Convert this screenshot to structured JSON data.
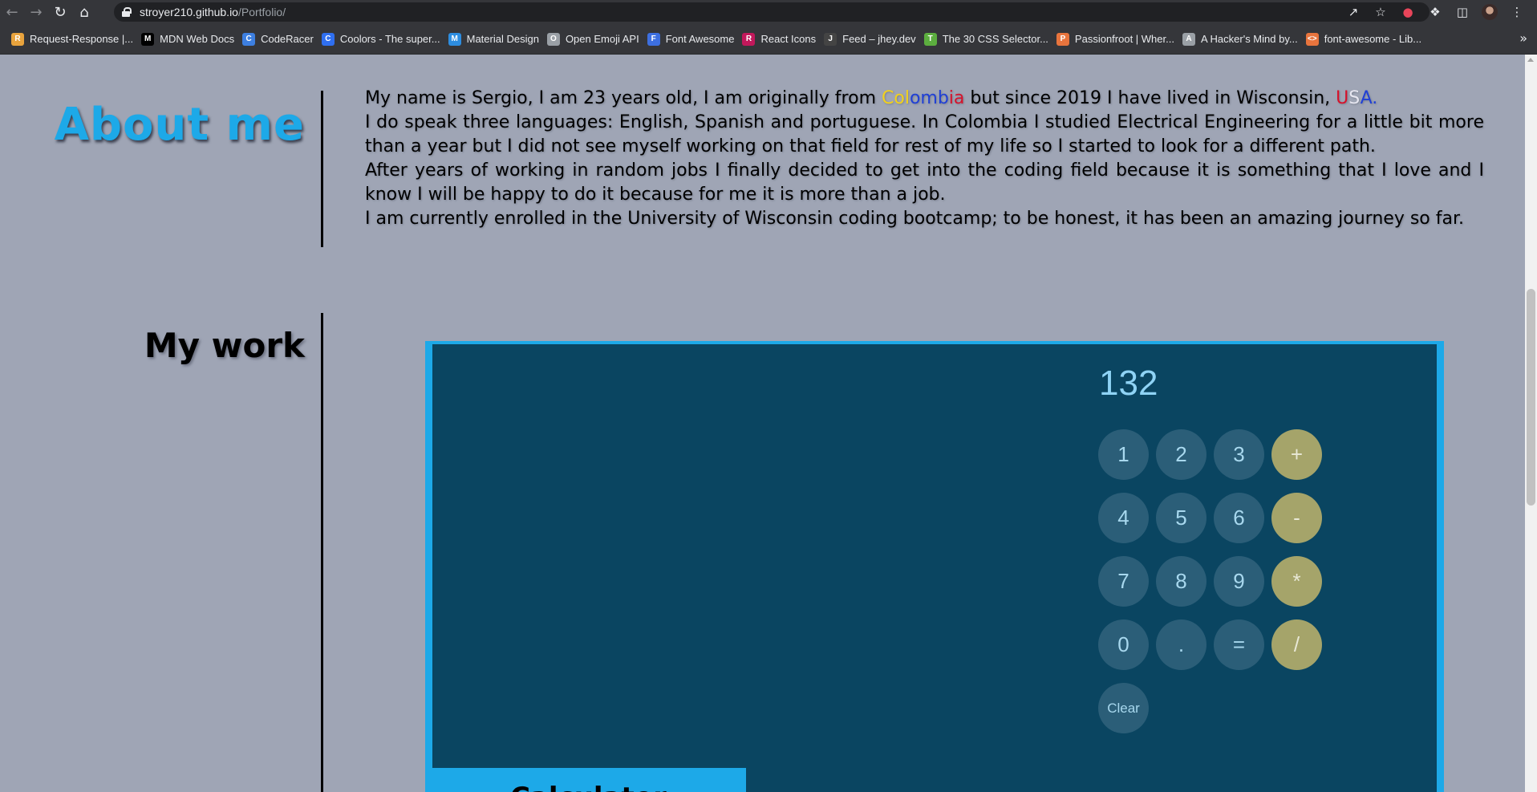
{
  "browser": {
    "url_host": "stroyer210.github.io",
    "url_path": "/Portfolio/",
    "bookmarks": [
      {
        "label": "Request-Response |...",
        "color": "#e8a33d",
        "glyph": "R"
      },
      {
        "label": "MDN Web Docs",
        "color": "#000000",
        "glyph": "M"
      },
      {
        "label": "CodeRacer",
        "color": "#3d7fe0",
        "glyph": "C"
      },
      {
        "label": "Coolors - The super...",
        "color": "#2f6ff0",
        "glyph": "C"
      },
      {
        "label": "Material Design",
        "color": "#2d8de0",
        "glyph": "M"
      },
      {
        "label": "Open Emoji API",
        "color": "#9aa0a6",
        "glyph": "O"
      },
      {
        "label": "Font Awesome",
        "color": "#3d6fe0",
        "glyph": "F"
      },
      {
        "label": "React Icons",
        "color": "#c2185b",
        "glyph": "R"
      },
      {
        "label": "Feed – jhey.dev",
        "color": "#444444",
        "glyph": "J"
      },
      {
        "label": "The 30 CSS Selector...",
        "color": "#5cae3f",
        "glyph": "T"
      },
      {
        "label": "Passionfroot | Wher...",
        "color": "#e8743d",
        "glyph": "P"
      },
      {
        "label": "A Hacker's Mind by...",
        "color": "#9aa0a6",
        "glyph": "A"
      },
      {
        "label": "font-awesome - Lib...",
        "color": "#e8743d",
        "glyph": "<>"
      }
    ]
  },
  "about": {
    "title": "About me",
    "p1_a": "My name is Sergio, I am 23 years old, I am originally from ",
    "p1_col_1": "Col",
    "p1_col_2": "omb",
    "p1_col_3": "ia",
    "p1_b": " but since 2019 I have lived in Wisconsin, ",
    "p1_usa_1": "U",
    "p1_usa_2": "S",
    "p1_usa_3": "A",
    "p1_usa_4": ".",
    "p2": "I do speak three languages: English, Spanish and portuguese. In Colombia I studied Electrical Engineering for a little bit more than a year but I did not see myself working on that field for rest of my life so I started to look for a different path.",
    "p3": "After years of working in random jobs I finally decided to get into the coding field because it is something that I love and I know I will be happy to do it because for me it is more than a job.",
    "p4": "I am currently enrolled in the University of Wisconsin coding bootcamp; to be honest, it has been an amazing journey so far."
  },
  "work": {
    "title": "My work",
    "project_label": "Calculator",
    "calculator": {
      "display": "132",
      "buttons": [
        "1",
        "2",
        "3",
        "+",
        "4",
        "5",
        "6",
        "-",
        "7",
        "8",
        "9",
        "*",
        "0",
        ".",
        "=",
        "/",
        "Clear"
      ]
    }
  }
}
